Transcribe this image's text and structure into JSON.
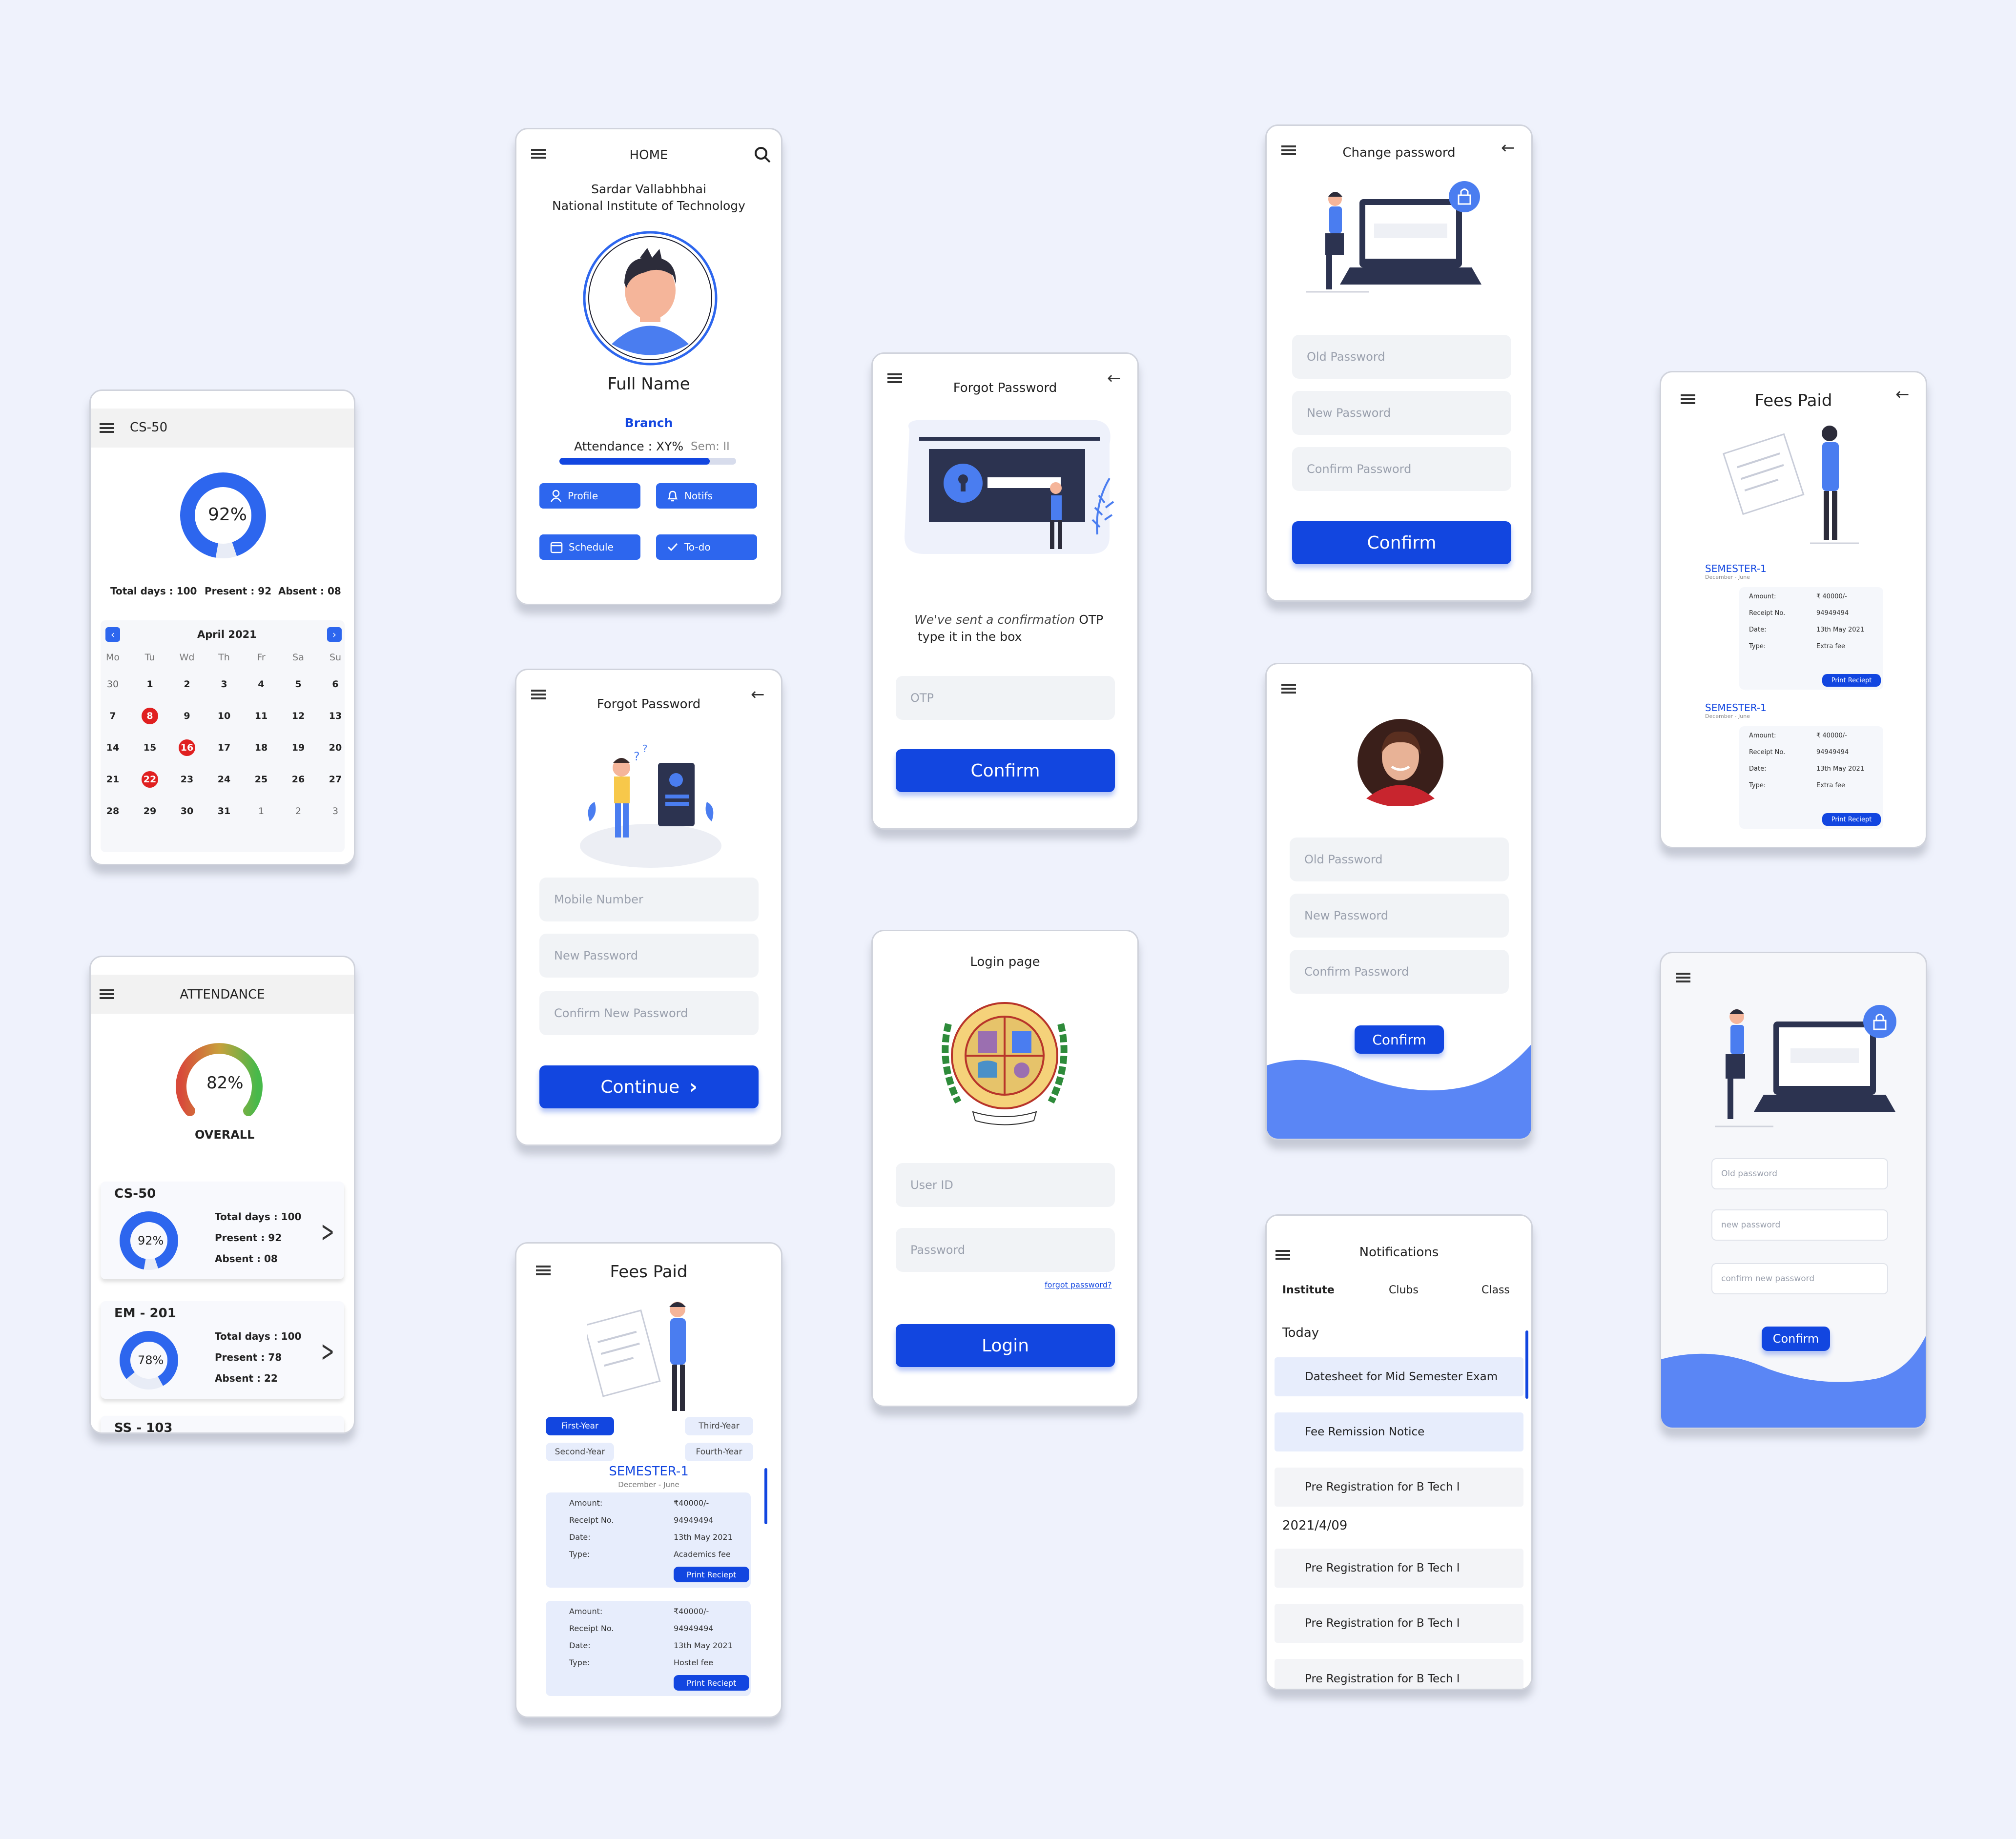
{
  "colors": {
    "background": "#eff2fc",
    "primary": "#1246e0",
    "accent": "#2d66ee",
    "wave": "#5a86f5",
    "red": "#e02020",
    "green": "#4cbb4c"
  },
  "dashboard": {
    "class": "CS-50",
    "percent": "92%",
    "total": "Total days : 100",
    "present": "Present : 92",
    "absent": "Absent : 08",
    "month": "April 2021",
    "weekdays": [
      "Mo",
      "Tu",
      "Wd",
      "Th",
      "Fr",
      "Sa",
      "Su"
    ],
    "rows": [
      [
        "30",
        "1",
        "2",
        "3",
        "4",
        "5",
        "6"
      ],
      [
        "7",
        "8",
        "9",
        "10",
        "11",
        "12",
        "13"
      ],
      [
        "14",
        "15",
        "16",
        "17",
        "18",
        "19",
        "20"
      ],
      [
        "21",
        "22",
        "23",
        "24",
        "25",
        "26",
        "27"
      ],
      [
        "28",
        "29",
        "30",
        "31",
        "1",
        "2",
        "3"
      ]
    ]
  },
  "attendance": {
    "title": "ATTENDANCE",
    "overall_percent": "82%",
    "overall_label": "OVERALL",
    "courses": [
      {
        "name": "CS-50",
        "percent": "92%",
        "total": "Total days : 100",
        "present": "Present : 92",
        "absent": "Absent : 08"
      },
      {
        "name": "EM - 201",
        "percent": "78%",
        "total": "Total days : 100",
        "present": "Present : 78",
        "absent": "Absent : 22"
      }
    ],
    "next_course": "SS - 103"
  },
  "home": {
    "title": "HOME",
    "inst1": "Sardar Vallabhbhai",
    "inst2": "National Institute of Technology",
    "name": "Full Name",
    "branch": "Branch",
    "attendance": "Attendance : XY%",
    "sem": "Sem: II",
    "progress": 0.85,
    "buttons": {
      "profile": "Profile",
      "notifs": "Notifs",
      "schedule": "Schedule",
      "todo": "To-do"
    }
  },
  "forgot1": {
    "title": "Forgot Password",
    "mobile": "Mobile Number",
    "new": "New Password",
    "confirm": "Confirm New Password",
    "continue": "Continue"
  },
  "fees_left": {
    "title": "Fees Paid",
    "years": [
      "First-Year",
      "Third-Year",
      "Second-Year",
      "Fourth-Year"
    ],
    "semester": "SEMESTER-1",
    "period": "December - June",
    "receipts": [
      {
        "amount_k": "Amount:",
        "amount": "₹40000/-",
        "receipt_k": "Receipt No.",
        "receipt": "94949494",
        "date_k": "Date:",
        "date": "13th May 2021",
        "type_k": "Type:",
        "type": "Academics fee",
        "print": "Print Reciept"
      },
      {
        "amount_k": "Amount:",
        "amount": "₹40000/-",
        "receipt_k": "Receipt No.",
        "receipt": "94949494",
        "date_k": "Date:",
        "date": "13th May 2021",
        "type_k": "Type:",
        "type": "Hostel fee",
        "print": "Print Reciept"
      }
    ]
  },
  "otp": {
    "title": "Forgot Password",
    "msg_pre": "We've sent a confirmation ",
    "msg_bold": "OTP",
    "msg2": "type it in the box",
    "placeholder": "OTP",
    "confirm": "Confirm"
  },
  "login": {
    "title": "Login page",
    "user": "User ID",
    "password": "Password",
    "forgot": "forgot password?",
    "login": "Login"
  },
  "change": {
    "title": "Change password",
    "old": "Old Password",
    "new": "New Password",
    "confirm_pw": "Confirm Password",
    "confirm": "Confirm"
  },
  "profile_change": {
    "old": "Old Password",
    "new": "New Password",
    "confirm_pw": "Confirm Password",
    "confirm": "Confirm"
  },
  "notifications": {
    "title": "Notifications",
    "tabs": [
      "Institute",
      "Clubs",
      "Class"
    ],
    "today": "Today",
    "today_items": [
      "Datesheet for Mid Semester Exam",
      "Fee Remission Notice",
      "Pre Registration for B Tech I"
    ],
    "date": "2021/4/09",
    "date_items": [
      "Pre Registration for B Tech I",
      "Pre Registration for B Tech I",
      "Pre Registration for B Tech I"
    ]
  },
  "fees_right": {
    "title": "Fees Paid",
    "blocks": [
      {
        "semester": "SEMESTER-1",
        "period": "December - June",
        "amount_k": "Amount:",
        "amount": "₹ 40000/-",
        "receipt_k": "Receipt No.",
        "receipt": "94949494",
        "date_k": "Date:",
        "date": "13th May 2021",
        "type_k": "Type:",
        "type": "Extra fee",
        "print": "Print Reciept"
      },
      {
        "semester": "SEMESTER-1",
        "period": "December - June",
        "amount_k": "Amount:",
        "amount": "₹ 40000/-",
        "receipt_k": "Receipt No.",
        "receipt": "94949494",
        "date_k": "Date:",
        "date": "13th May 2021",
        "type_k": "Type:",
        "type": "Extra fee",
        "print": "Print Reciept"
      }
    ]
  },
  "laptop_change": {
    "old": "Old password",
    "new": "new password",
    "confirm_pw": "confirm new password",
    "confirm": "Confirm"
  }
}
